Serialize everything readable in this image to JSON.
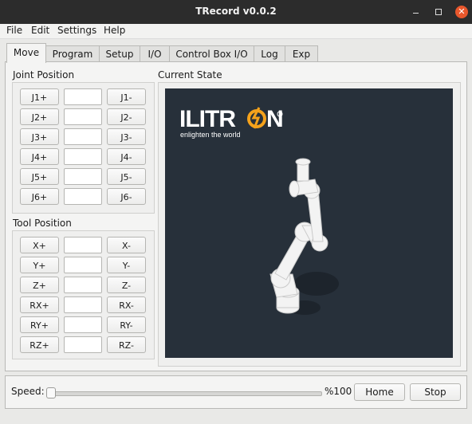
{
  "window": {
    "title": "TRecord v0.0.2",
    "minimize_glyph": "—",
    "maximize_glyph": "□",
    "close_glyph": "✕"
  },
  "menu": [
    "File",
    "Edit",
    "Settings",
    "Help"
  ],
  "tabs": [
    "Move",
    "Program",
    "Setup",
    "I/O",
    "Control Box I/O",
    "Log",
    "Exp"
  ],
  "joint_position": {
    "title": "Joint Position",
    "rows": [
      {
        "plus": "J1+",
        "minus": "J1-",
        "value": ""
      },
      {
        "plus": "J2+",
        "minus": "J2-",
        "value": ""
      },
      {
        "plus": "J3+",
        "minus": "J3-",
        "value": ""
      },
      {
        "plus": "J4+",
        "minus": "J4-",
        "value": ""
      },
      {
        "plus": "J5+",
        "minus": "J5-",
        "value": ""
      },
      {
        "plus": "J6+",
        "minus": "J6-",
        "value": ""
      }
    ]
  },
  "tool_position": {
    "title": "Tool Position",
    "rows": [
      {
        "plus": "X+",
        "minus": "X-",
        "value": ""
      },
      {
        "plus": "Y+",
        "minus": "Y-",
        "value": ""
      },
      {
        "plus": "Z+",
        "minus": "Z-",
        "value": ""
      },
      {
        "plus": "RX+",
        "minus": "RX-",
        "value": ""
      },
      {
        "plus": "RY+",
        "minus": "RY-",
        "value": ""
      },
      {
        "plus": "RZ+",
        "minus": "RZ-",
        "value": ""
      }
    ]
  },
  "current_state": {
    "title": "Current State",
    "logo_text": "ILITRON",
    "logo_tagline": "enlighten the world",
    "colors": {
      "background": "#27303a",
      "logo_accent": "#f5a21b",
      "robot": "#f2f2f2"
    }
  },
  "bottom": {
    "speed_label": "Speed:",
    "speed_value": "%100",
    "speed_fraction": 0.0,
    "home_label": "Home",
    "stop_label": "Stop"
  }
}
